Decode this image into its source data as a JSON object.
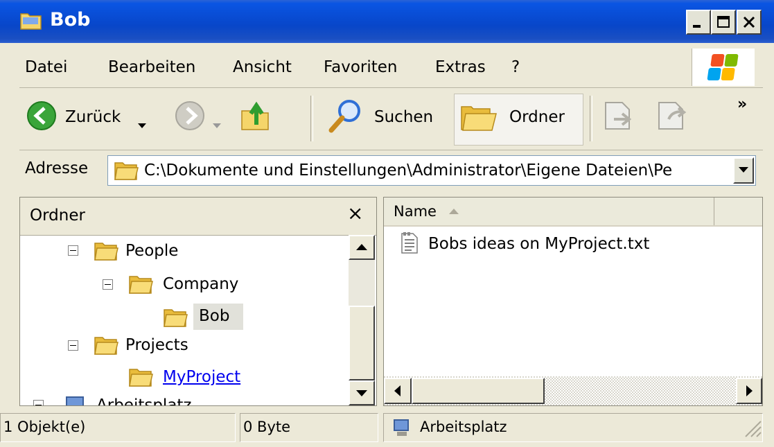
{
  "window": {
    "title": "Bob"
  },
  "menubar": {
    "items": [
      "Datei",
      "Bearbeiten",
      "Ansicht",
      "Favoriten",
      "Extras",
      "?"
    ]
  },
  "toolbar": {
    "back_label": "Zurück",
    "search_label": "Suchen",
    "folders_label": "Ordner",
    "overflow": "»"
  },
  "address": {
    "label": "Adresse",
    "value": "C:\\Dokumente und Einstellungen\\Administrator\\Eigene Dateien\\Pe"
  },
  "folder_pane": {
    "title": "Ordner",
    "close": "×",
    "tree": [
      {
        "label": "People",
        "expander": true
      },
      {
        "label": "Company",
        "expander": true
      },
      {
        "label": "Bob",
        "expander": false,
        "selected": true
      },
      {
        "label": "Projects",
        "expander": true
      },
      {
        "label": "MyProject",
        "expander": false,
        "hover": true
      },
      {
        "label": "Arbeitsplatz",
        "expander": true,
        "partially_visible": true
      }
    ]
  },
  "file_pane": {
    "column_header": "Name",
    "sort_icon": "sort-ascending-icon",
    "files": [
      {
        "name": "Bobs ideas on MyProject.txt",
        "icon": "text-file-icon"
      }
    ]
  },
  "statusbar": {
    "objects": "1 Objekt(e)",
    "size": "0 Byte",
    "zone": "Arbeitsplatz"
  },
  "colors": {
    "titlebar": "#0a55e3",
    "chrome": "#ece9d8",
    "link": "#0000ee",
    "selection": "#e1e1da"
  }
}
